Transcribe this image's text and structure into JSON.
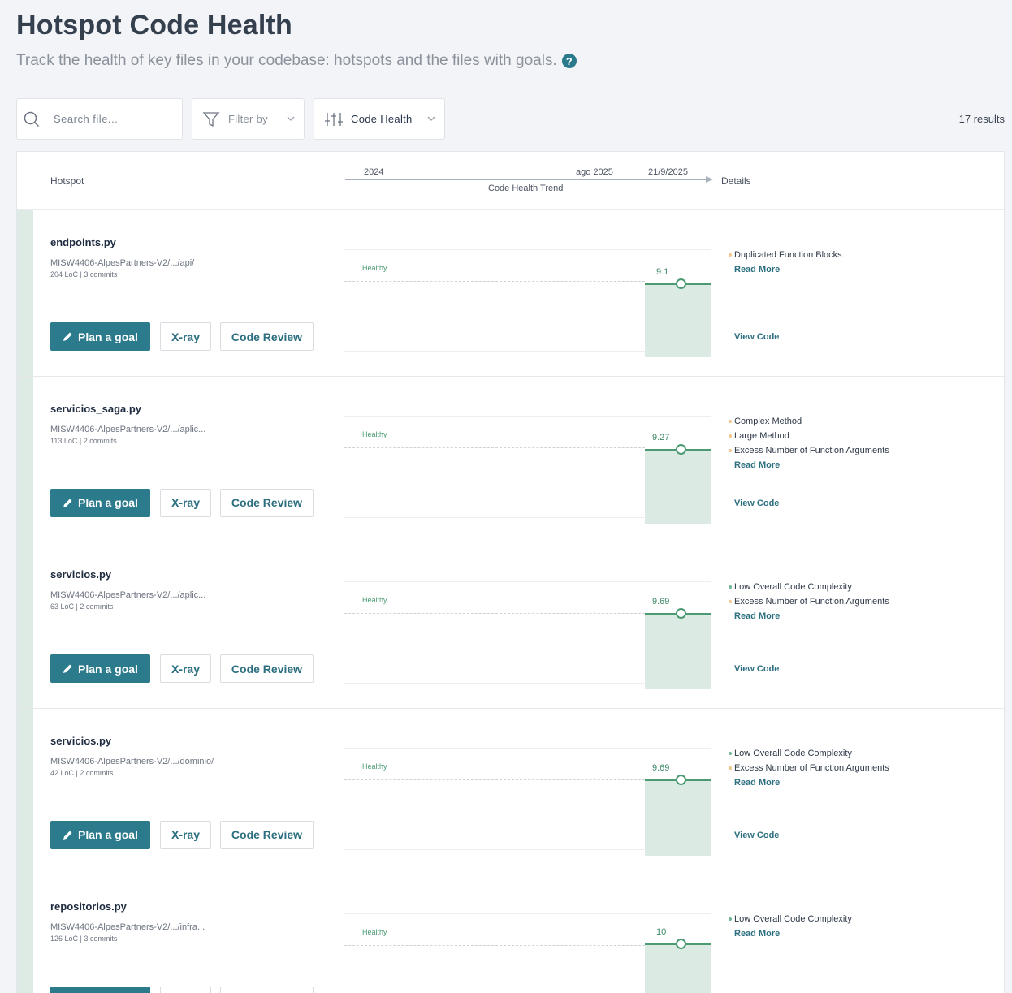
{
  "page": {
    "title": "Hotspot Code Health",
    "subtitle": "Track the health of key files in your codebase: hotspots and the files with goals.",
    "help_icon": "?"
  },
  "toolbar": {
    "search_placeholder": "Search file...",
    "filter_label": "Filter by",
    "sort_label": "Code Health",
    "results": "17 results"
  },
  "table": {
    "col_hotspot": "Hotspot",
    "col_details": "Details",
    "trend_label": "Code Health Trend",
    "ticks": [
      "2024",
      "ago 2025",
      "21/9/2025"
    ]
  },
  "buttons": {
    "plan": "Plan a goal",
    "xray": "X-ray",
    "review": "Code Review",
    "read_more": "Read More",
    "view_code": "View Code"
  },
  "chart_common": {
    "band_label": "Healthy"
  },
  "rows": [
    {
      "name": "endpoints.py",
      "path": "MISW4406-AlpesPartners-V2/.../api/",
      "meta": "204 LoC | 3 commits",
      "score": "9.1",
      "score_value": 9.1,
      "issues": [
        {
          "text": "Duplicated Function Blocks",
          "kind": "warn"
        }
      ]
    },
    {
      "name": "servicios_saga.py",
      "path": "MISW4406-AlpesPartners-V2/.../aplic...",
      "meta": "113 LoC | 2 commits",
      "score": "9.27",
      "score_value": 9.27,
      "issues": [
        {
          "text": "Complex Method",
          "kind": "warn"
        },
        {
          "text": "Large Method",
          "kind": "warn"
        },
        {
          "text": "Excess Number of Function Arguments",
          "kind": "warn"
        }
      ]
    },
    {
      "name": "servicios.py",
      "path": "MISW4406-AlpesPartners-V2/.../aplic...",
      "meta": "63 LoC | 2 commits",
      "score": "9.69",
      "score_value": 9.69,
      "issues": [
        {
          "text": "Low Overall Code Complexity",
          "kind": "ok"
        },
        {
          "text": "Excess Number of Function Arguments",
          "kind": "warn"
        }
      ]
    },
    {
      "name": "servicios.py",
      "path": "MISW4406-AlpesPartners-V2/.../dominio/",
      "meta": "42 LoC | 2 commits",
      "score": "9.69",
      "score_value": 9.69,
      "issues": [
        {
          "text": "Low Overall Code Complexity",
          "kind": "ok"
        },
        {
          "text": "Excess Number of Function Arguments",
          "kind": "warn"
        }
      ]
    },
    {
      "name": "repositorios.py",
      "path": "MISW4406-AlpesPartners-V2/.../infra...",
      "meta": "126 LoC | 3 commits",
      "score": "10",
      "score_value": 10,
      "issues": [
        {
          "text": "Low Overall Code Complexity",
          "kind": "ok"
        }
      ]
    }
  ],
  "colors": {
    "accent": "#2c7b8c",
    "healthy": "#4b9a72",
    "warning": "#f1c68a"
  }
}
